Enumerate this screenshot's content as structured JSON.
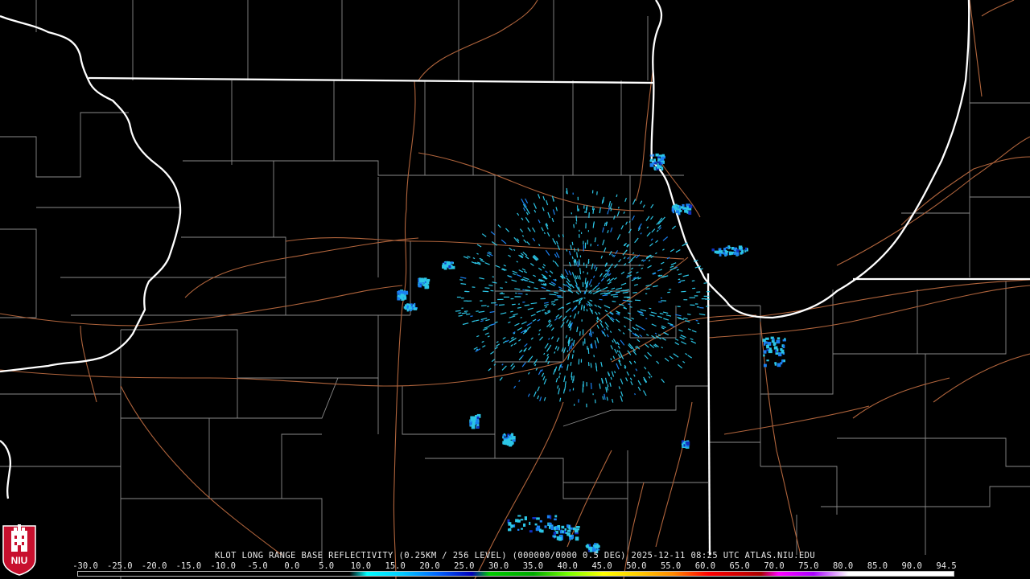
{
  "header": {
    "product_text": "KLOT LONG RANGE BASE REFLECTIVITY (0.25KM / 256 LEVEL) (000000/0000 0.5 DEG) 2025-12-11 08:25 UTC  ATLAS.NIU.EDU"
  },
  "scale": {
    "labels": [
      "-30.0",
      "-25.0",
      "-20.0",
      "-15.0",
      "-10.0",
      "-5.0",
      "0.0",
      "5.0",
      "10.0",
      "15.0",
      "20.0",
      "25.0",
      "30.0",
      "35.0",
      "40.0",
      "45.0",
      "50.0",
      "55.0",
      "60.0",
      "65.0",
      "70.0",
      "75.0",
      "80.0",
      "85.0",
      "90.0",
      "94.5"
    ],
    "min": -30.0,
    "max": 94.5
  },
  "logo": {
    "text": "NIU",
    "color": "#c8102e"
  },
  "colors": {
    "background": "#000000",
    "state_lines": "#ffffff",
    "county_lines": "#8a8a8a",
    "roads": "#b0643c",
    "echo_light": "#2cc6e6",
    "echo_mid": "#1a7ff0",
    "echo_dark": "#1030c0"
  }
}
